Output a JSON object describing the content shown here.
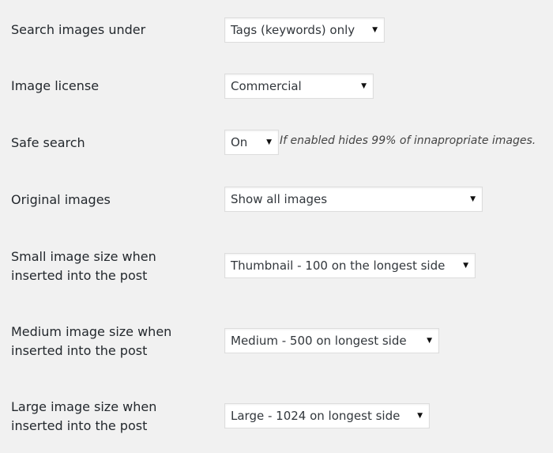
{
  "settings": {
    "search_under": {
      "label": "Search images under",
      "value": "Tags (keywords) only"
    },
    "license": {
      "label": "Image license",
      "value": "Commercial"
    },
    "safe_search": {
      "label": "Safe search",
      "value": "On",
      "hint": "If enabled hides 99% of innapropriate images."
    },
    "original": {
      "label": "Original images",
      "value": "Show all images"
    },
    "small_size": {
      "label_line1": "Small image size when",
      "label_line2": "inserted into the post",
      "value": "Thumbnail - 100 on the longest side"
    },
    "medium_size": {
      "label_line1": "Medium image size when",
      "label_line2": "inserted into the post",
      "value": "Medium - 500 on longest side"
    },
    "large_size": {
      "label_line1": "Large image size when",
      "label_line2": "inserted into the post",
      "value": "Large - 1024 on longest side"
    }
  },
  "icons": {
    "dropdown": "caret-down-icon"
  },
  "colors": {
    "background": "#f1f1f1",
    "select_bg": "#ffffff",
    "border": "#dddddd"
  }
}
